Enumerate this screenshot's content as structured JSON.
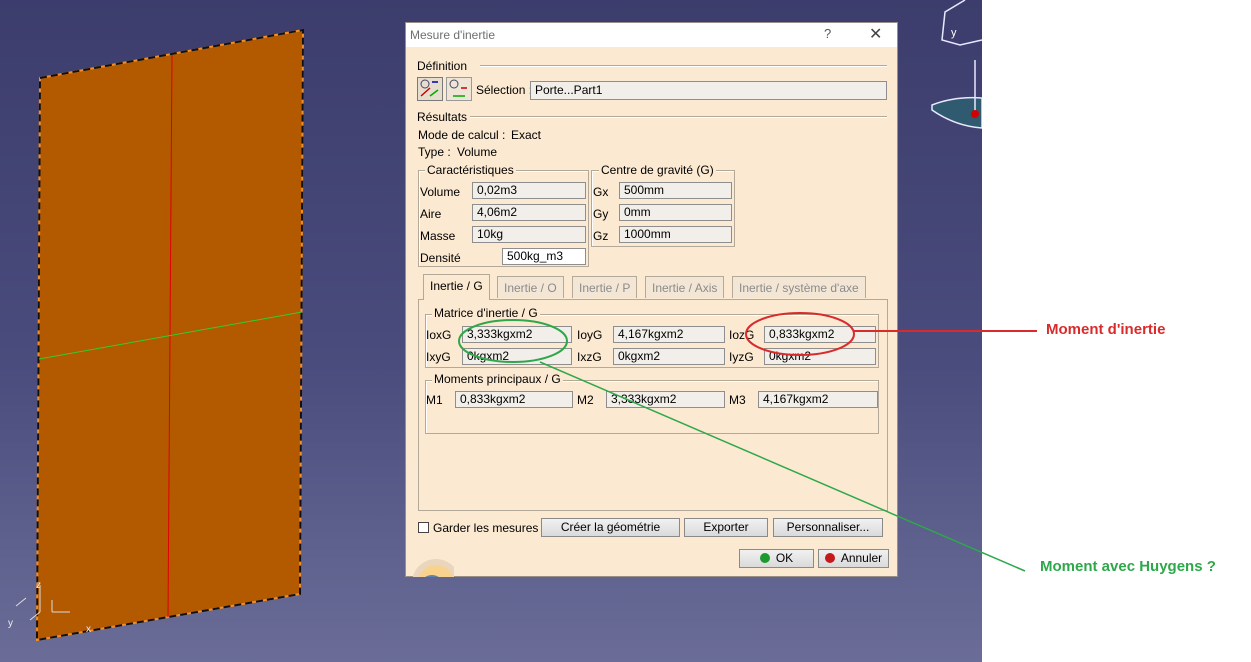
{
  "dialog": {
    "title": "Mesure d'inertie",
    "help_glyph": "?",
    "close_glyph": "✕",
    "definition": {
      "heading": "Définition",
      "selection_label": "Sélection :",
      "selection_value": "Porte...Part1"
    },
    "results": {
      "heading": "Résultats",
      "mode_label": "Mode de calcul :",
      "mode_value": "Exact",
      "type_label": "Type :",
      "type_value": "Volume"
    },
    "characteristics": {
      "heading": "Caractéristiques",
      "rows": [
        {
          "label": "Volume",
          "value": "0,02m3"
        },
        {
          "label": "Aire",
          "value": "4,06m2"
        },
        {
          "label": "Masse",
          "value": "10kg"
        },
        {
          "label": "Densité",
          "value": "500kg_m3"
        }
      ]
    },
    "gravity": {
      "heading": "Centre de gravité (G)",
      "rows": [
        {
          "label": "Gx",
          "value": "500mm"
        },
        {
          "label": "Gy",
          "value": "0mm"
        },
        {
          "label": "Gz",
          "value": "1000mm"
        }
      ]
    },
    "tabs": [
      "Inertie / G",
      "Inertie / O",
      "Inertie / P",
      "Inertie / Axis",
      "Inertie / système d'axe"
    ],
    "active_tab": "Inertie / G",
    "matrix": {
      "heading": "Matrice d'inertie / G",
      "row1": [
        {
          "label": "IoxG",
          "value": "3,333kgxm2"
        },
        {
          "label": "IoyG",
          "value": "4,167kgxm2"
        },
        {
          "label": "IozG",
          "value": "0,833kgxm2"
        }
      ],
      "row2": [
        {
          "label": "IxyG",
          "value": "0kgxm2"
        },
        {
          "label": "IxzG",
          "value": "0kgxm2"
        },
        {
          "label": "IyzG",
          "value": "0kgxm2"
        }
      ]
    },
    "principal": {
      "heading": "Moments principaux / G",
      "rows": [
        {
          "label": "M1",
          "value": "0,833kgxm2"
        },
        {
          "label": "M2",
          "value": "3,333kgxm2"
        },
        {
          "label": "M3",
          "value": "4,167kgxm2"
        }
      ]
    },
    "keep_measures_label": "Garder les mesures",
    "buttons": {
      "create_geometry": "Créer la géométrie",
      "export": "Exporter",
      "customize": "Personnaliser...",
      "ok": "OK",
      "cancel": "Annuler"
    }
  },
  "viewport": {
    "axis_labels": {
      "z": "z",
      "y": "y",
      "x": "x"
    },
    "compass_label": "y"
  },
  "annotations": {
    "moment_inertie": "Moment d'inertie",
    "moment_huygens": "Moment avec Huygens ?"
  },
  "colors": {
    "panel_fill": "#b35900",
    "annotation_red": "#d92b2b",
    "annotation_green": "#2ea84a",
    "dialog_bg": "#fbe9d1"
  }
}
